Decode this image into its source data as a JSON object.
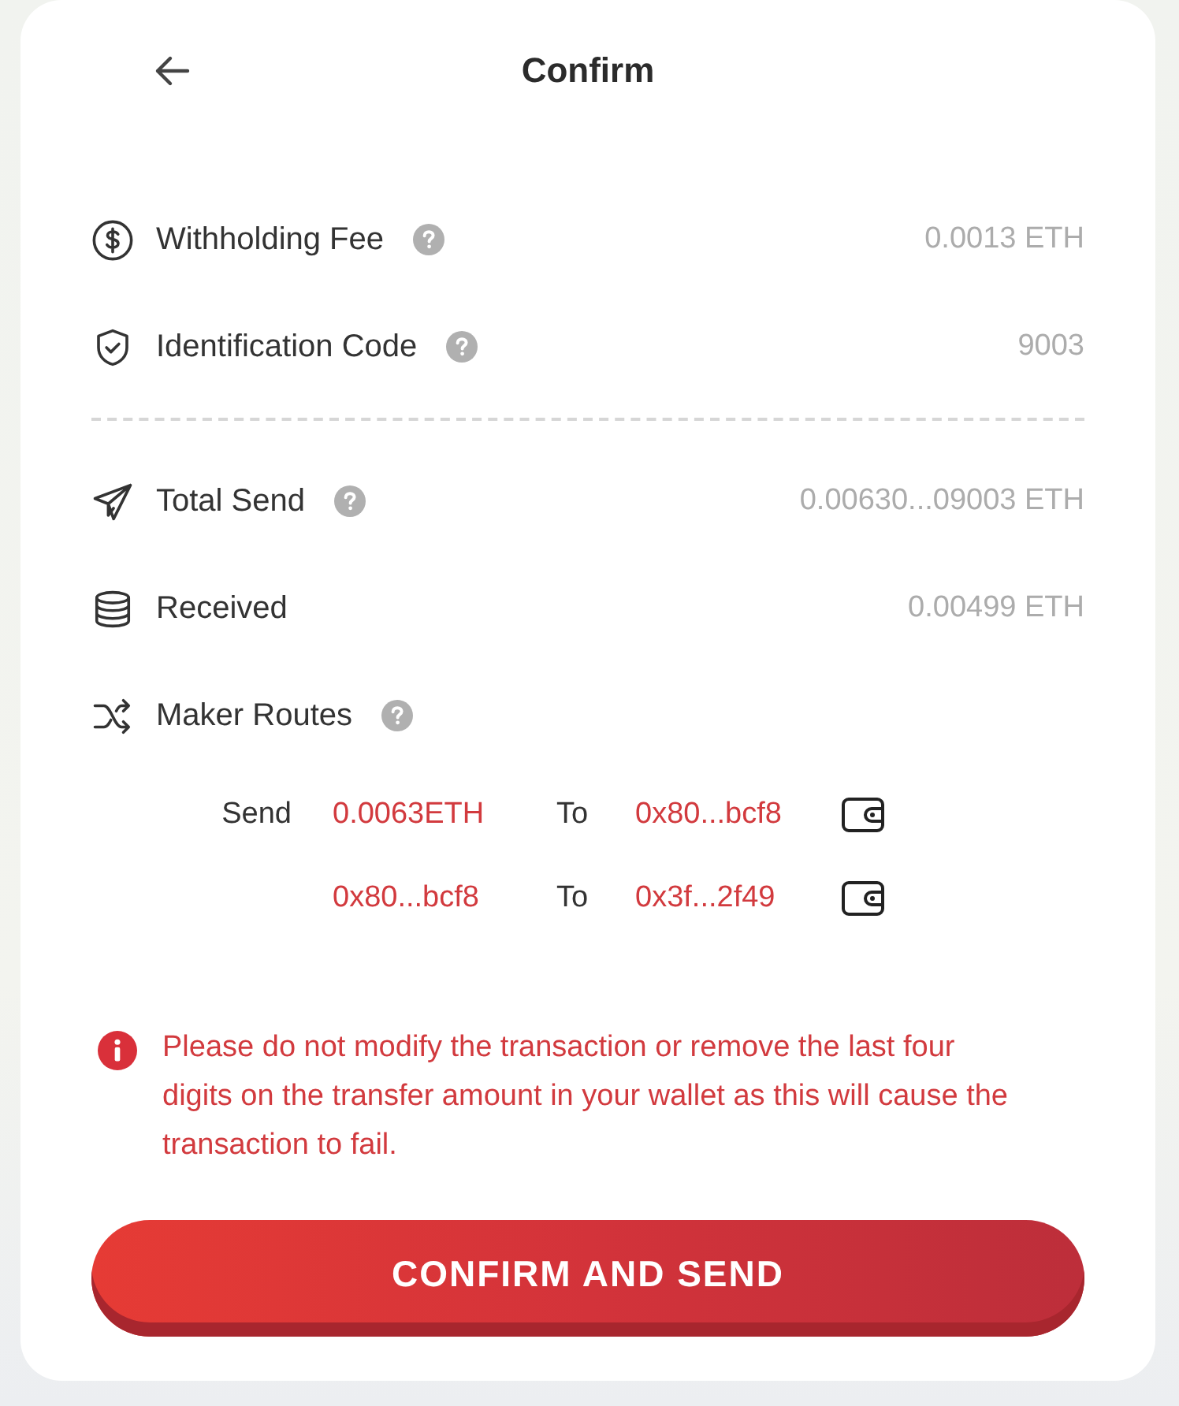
{
  "header": {
    "title": "Confirm"
  },
  "fee_rows": [
    {
      "label": "Withholding Fee",
      "help": true,
      "value": "0.0013 ETH"
    },
    {
      "label": "Identification Code",
      "help": true,
      "value": "9003"
    }
  ],
  "send_rows": [
    {
      "label": "Total Send",
      "help": true,
      "value": "0.00630...09003 ETH"
    },
    {
      "label": "Received",
      "help": false,
      "value": "0.00499 ETH"
    },
    {
      "label": "Maker Routes",
      "help": true
    }
  ],
  "routes": [
    {
      "label": "Send",
      "from": "0.0063ETH",
      "connector": "To",
      "to": "0x80...bcf8"
    },
    {
      "from": "0x80...bcf8",
      "connector": "To",
      "to": "0x3f...2f49"
    }
  ],
  "warning": "Please do not modify the transaction or remove the last four digits on the transfer amount in your wallet as this will cause the transaction to fail.",
  "button": {
    "label": "CONFIRM AND SEND"
  }
}
